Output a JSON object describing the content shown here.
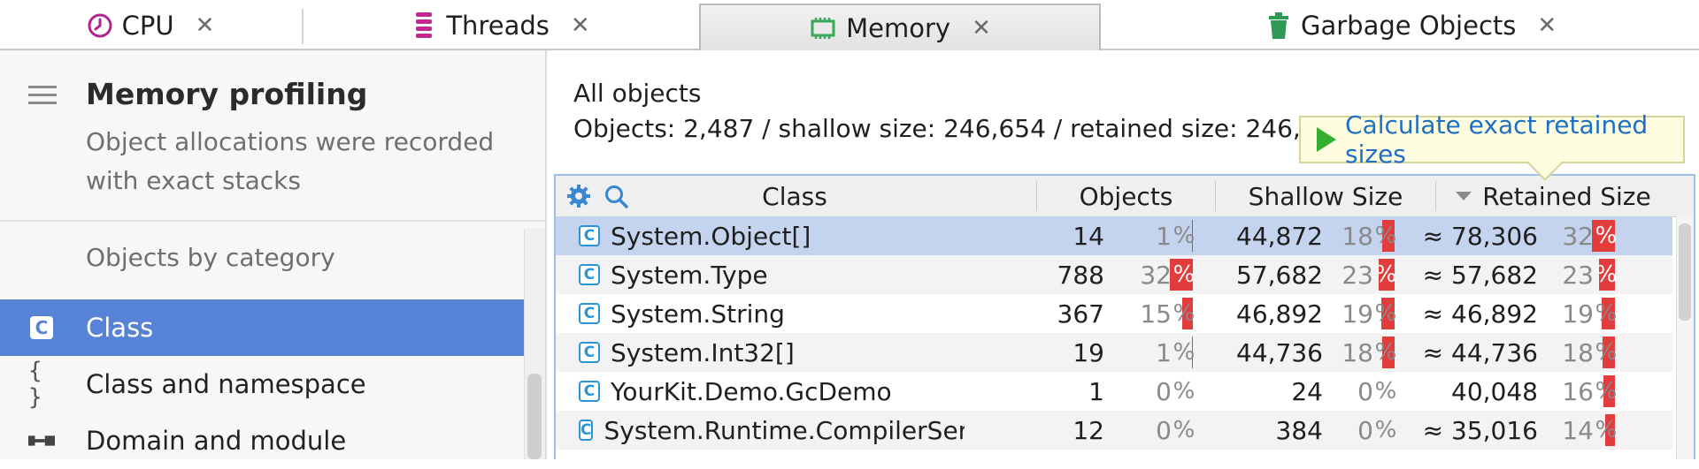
{
  "tabs": [
    {
      "label": "CPU",
      "icon": "clock-icon",
      "close": "✕"
    },
    {
      "label": "Threads",
      "icon": "threads-icon",
      "close": "✕"
    },
    {
      "label": "Memory",
      "icon": "memory-chip-icon",
      "close": "✕"
    },
    {
      "label": "Garbage Objects",
      "icon": "trash-icon",
      "close": "✕"
    }
  ],
  "active_tab": "Memory",
  "sidebar": {
    "title": "Memory profiling",
    "description": "Object allocations were recorded with exact stacks",
    "section_label": "Objects by category",
    "items": [
      {
        "label": "Class",
        "icon": "class-c-icon",
        "glyph": "C",
        "selected": true
      },
      {
        "label": "Class and namespace",
        "icon": "braces-icon",
        "glyph": "{ }",
        "selected": false
      },
      {
        "label": "Domain and module",
        "icon": "module-icon",
        "glyph": "▪▬▪",
        "selected": false
      }
    ]
  },
  "main": {
    "title": "All objects",
    "summary": "Objects: 2,487 / shallow size: 246,654 / retained size: 246,654",
    "tooltip": "Calculate exact retained sizes",
    "columns": {
      "class": "Class",
      "objects": "Objects",
      "shallow": "Shallow Size",
      "retained": "Retained Size"
    },
    "sort_column": "Retained Size",
    "rows": [
      {
        "class": "System.Object[]",
        "objects": "14",
        "objects_pct": "1",
        "shallow": "44,872",
        "shallow_pct": "18",
        "retained": "≈ 78,306",
        "retained_pct": "32",
        "selected": true
      },
      {
        "class": "System.Type",
        "objects": "788",
        "objects_pct": "32",
        "shallow": "57,682",
        "shallow_pct": "23",
        "retained": "≈ 57,682",
        "retained_pct": "23"
      },
      {
        "class": "System.String",
        "objects": "367",
        "objects_pct": "15",
        "shallow": "46,892",
        "shallow_pct": "19",
        "retained": "≈ 46,892",
        "retained_pct": "19"
      },
      {
        "class": "System.Int32[]",
        "objects": "19",
        "objects_pct": "1",
        "shallow": "44,736",
        "shallow_pct": "18",
        "retained": "≈ 44,736",
        "retained_pct": "18"
      },
      {
        "class": "YourKit.Demo.GcDemo",
        "objects": "1",
        "objects_pct": "0",
        "shallow": "24",
        "shallow_pct": "0",
        "retained": "40,048",
        "retained_pct": "16"
      },
      {
        "class": "System.Runtime.CompilerServices.G",
        "objects": "12",
        "objects_pct": "0",
        "shallow": "384",
        "shallow_pct": "0",
        "retained": "≈ 35,016",
        "retained_pct": "14"
      }
    ]
  },
  "colors": {
    "accent": "#5783d6",
    "bar": "#e23c3c",
    "link": "#1e6fc7",
    "selected_row": "#c4d4ee"
  }
}
